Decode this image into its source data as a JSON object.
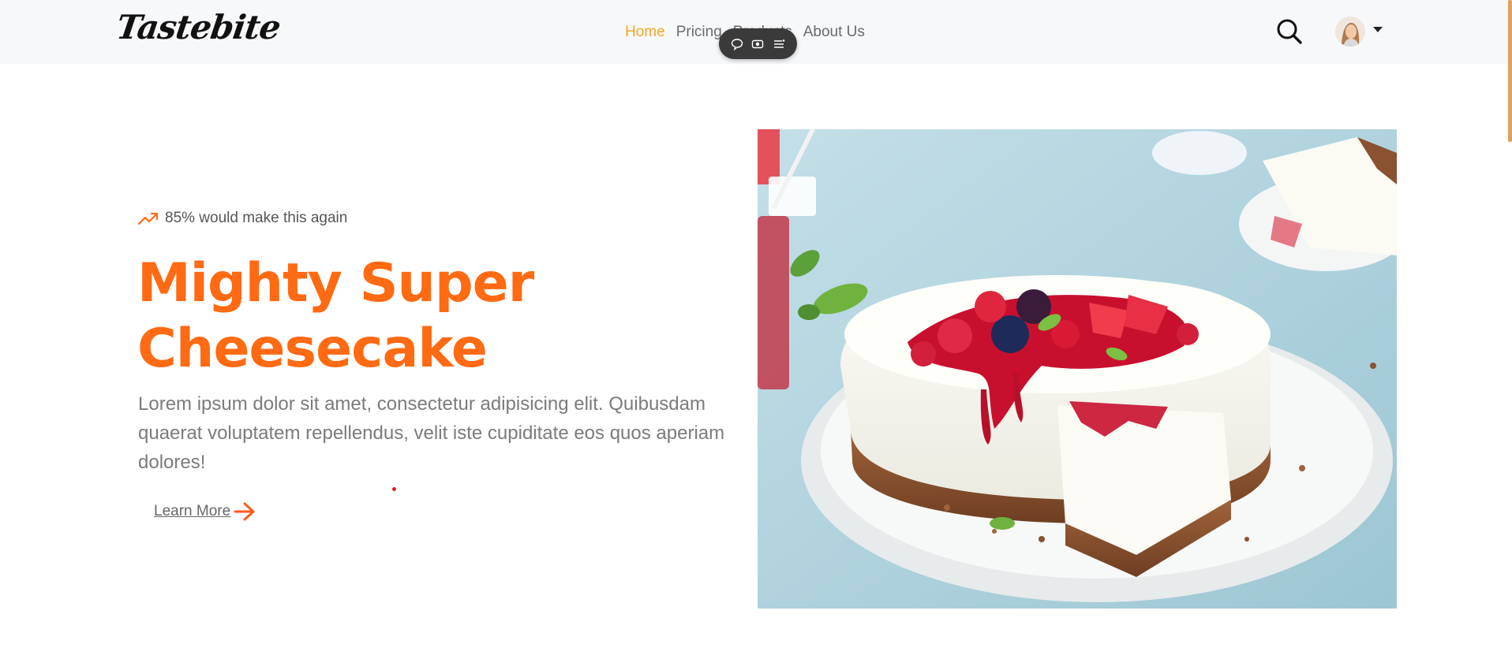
{
  "brand": {
    "name": "Tastebite"
  },
  "nav": {
    "items": [
      {
        "label": "Home",
        "active": true
      },
      {
        "label": "Pricing",
        "active": false
      },
      {
        "label": "Products",
        "active": false
      },
      {
        "label": "About Us",
        "active": false
      }
    ]
  },
  "toolbar": {
    "icons": [
      "comment-icon",
      "screen-record-icon",
      "menu-list-icon"
    ]
  },
  "header_actions": {
    "icons": [
      "search-icon",
      "avatar",
      "caret-down-icon"
    ]
  },
  "hero": {
    "stat": "85% would make this again",
    "stat_icon": "trending-up-icon",
    "title_line1": "Mighty Super",
    "title_line2": "Cheesecake",
    "description": "Lorem ipsum dolor sit amet, consectetur adipisicing elit. Quibusdam quaerat voluptatem repellendus, velit iste cupiditate eos quos aperiam dolores!",
    "cta_label": "Learn More",
    "cta_icon": "arrow-right-icon"
  },
  "colors": {
    "accent": "#ff6a13",
    "nav_active": "#f5a623",
    "header_bg": "#f7f8fa",
    "body_text": "#7b7b7b"
  }
}
